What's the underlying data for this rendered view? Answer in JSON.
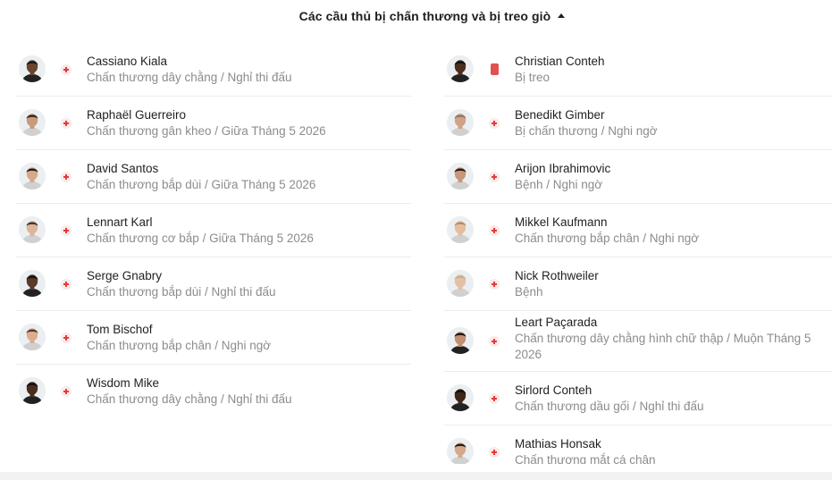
{
  "section": {
    "title": "Các cầu thủ bị chấn thương và bị treo giò",
    "caret_icon": "caret-up-icon"
  },
  "colors": {
    "injury_icon": "#e23b3b",
    "suspension_card": "#e0524f",
    "name_text": "#1f1f1f",
    "detail_text": "#8c8c8c"
  },
  "left_players": [
    {
      "name": "Cassiano Kiala",
      "detail": "Chấn thương dây chằng / Nghỉ thi đấu",
      "status": "injury",
      "skin": "#6b4530",
      "hair": "#1a1a1a",
      "kit": "#222222"
    },
    {
      "name": "Raphaël Guerreiro",
      "detail": "Chấn thương gân kheo / Giữa Tháng 5 2026",
      "status": "injury",
      "skin": "#c99a7c",
      "hair": "#3a2a20",
      "kit": "#d0d0d0"
    },
    {
      "name": "David Santos",
      "detail": "Chấn thương bắp dùi / Giữa Tháng 5 2026",
      "status": "injury",
      "skin": "#d6a98a",
      "hair": "#2a1d16",
      "kit": "#d0d0d0"
    },
    {
      "name": "Lennart Karl",
      "detail": "Chấn thương cơ bắp / Giữa Tháng 5 2026",
      "status": "injury",
      "skin": "#dcb59a",
      "hair": "#4a3526",
      "kit": "#d0d0d0"
    },
    {
      "name": "Serge Gnabry",
      "detail": "Chấn thương bắp dùi / Nghỉ thi đấu",
      "status": "injury",
      "skin": "#5a3a28",
      "hair": "#151515",
      "kit": "#222222"
    },
    {
      "name": "Tom Bischof",
      "detail": "Chấn thương bắp chân / Nghi ngờ",
      "status": "injury",
      "skin": "#dcae90",
      "hair": "#5a3a22",
      "kit": "#d0d0d0"
    },
    {
      "name": "Wisdom Mike",
      "detail": "Chấn thương dây chằng / Nghỉ thi đấu",
      "status": "injury",
      "skin": "#4a2e1e",
      "hair": "#121212",
      "kit": "#222222"
    }
  ],
  "right_players": [
    {
      "name": "Christian Conteh",
      "detail": "Bị treo",
      "status": "suspended",
      "skin": "#4a2e1e",
      "hair": "#121212",
      "kit": "#222222"
    },
    {
      "name": "Benedikt Gimber",
      "detail": "Bị chấn thương / Nghi ngờ",
      "status": "injury",
      "skin": "#d2a286",
      "hair": "#8a7a6a",
      "kit": "#d0d0d0"
    },
    {
      "name": "Arijon Ibrahimovic",
      "detail": "Bệnh / Nghi ngờ",
      "status": "injury",
      "skin": "#c8977a",
      "hair": "#2a1d16",
      "kit": "#d0d0d0"
    },
    {
      "name": "Mikkel Kaufmann",
      "detail": "Chấn thương bắp chân / Nghi ngờ",
      "status": "injury",
      "skin": "#e3bea3",
      "hair": "#b59060",
      "kit": "#d0d0d0"
    },
    {
      "name": "Nick Rothweiler",
      "detail": "Bệnh",
      "status": "injury",
      "skin": "#e4c0a6",
      "hair": "#c9b08a",
      "kit": "#d0d0d0"
    },
    {
      "name": "Leart Paçarada",
      "detail": "Chấn thương dây chằng hình chữ thập / Muộn Tháng 5 2026",
      "status": "injury",
      "skin": "#c28f70",
      "hair": "#1e1612",
      "kit": "#222222"
    },
    {
      "name": "Sirlord Conteh",
      "detail": "Chấn thương dầu gối / Nghỉ thi đấu",
      "status": "injury",
      "skin": "#3e2619",
      "hair": "#111111",
      "kit": "#222222"
    },
    {
      "name": "Mathias Honsak",
      "detail": "Chấn thương mắt cá chân",
      "status": "injury",
      "skin": "#d6a98a",
      "hair": "#2a1d16",
      "kit": "#d0d0d0"
    }
  ]
}
